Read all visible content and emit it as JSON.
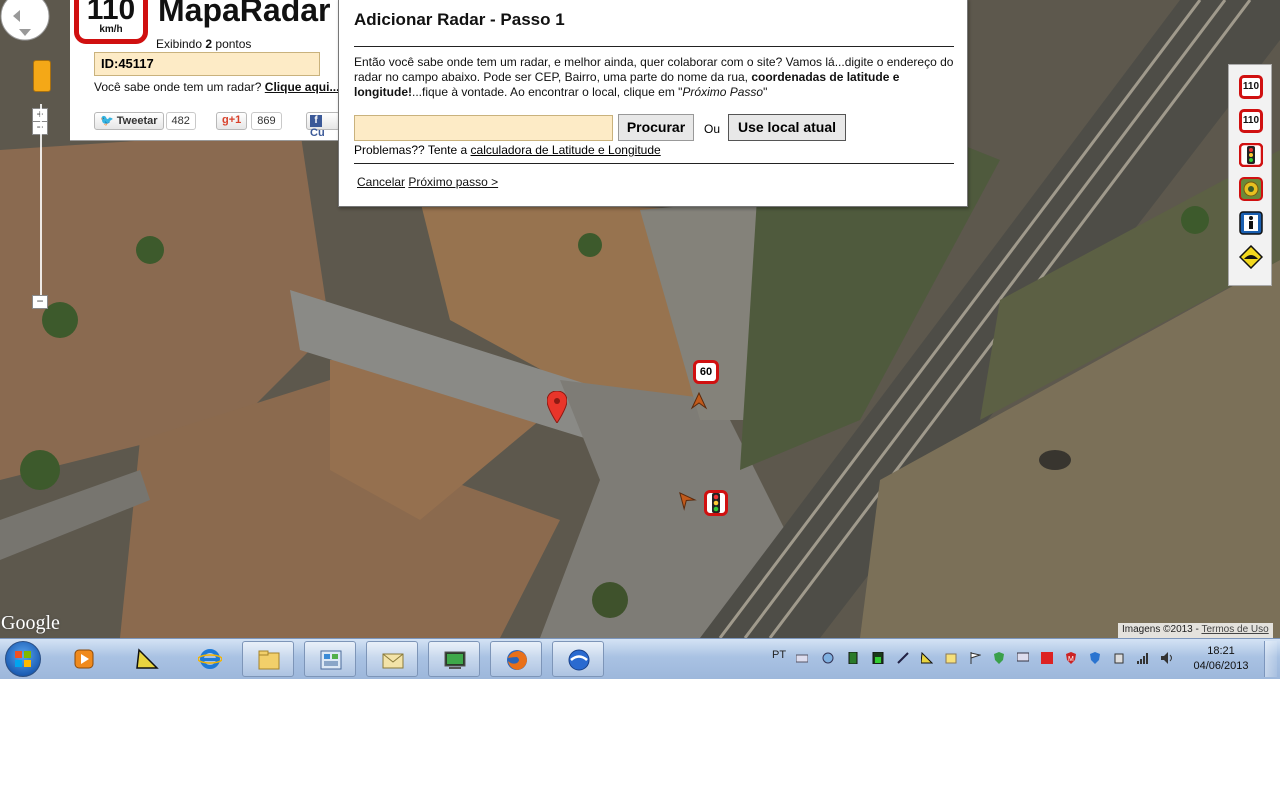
{
  "brand": {
    "sign_value": "110",
    "sign_unit": "km/h",
    "title": "MapaRadar",
    "points_prefix": "Exibindo ",
    "points_count": "2",
    "points_suffix": " pontos",
    "id_label": "ID:45117",
    "know_text": "Você sabe onde tem um radar? ",
    "know_link": "Clique aqui..."
  },
  "social": {
    "tweet_label": "Tweetar",
    "tweet_count": "482",
    "gplus_label": "+1",
    "gplus_count": "869",
    "fb_label": "Cu"
  },
  "dialog": {
    "title": "Adicionar Radar - Passo 1",
    "body_1": "Então você sabe onde tem um radar, e melhor ainda, quer colaborar com o site? Vamos lá...digite o endereço do radar no campo abaixo. Pode ser CEP, Bairro, uma parte do nome da rua, ",
    "body_bold": "coordenadas de latitude e longitude!",
    "body_2": "...fique à vontade. Ao encontrar o local, clique em \"",
    "body_italic": "Próximo Passo",
    "body_3": "\"",
    "address_value": "",
    "search_button": "Procurar",
    "or_text": "Ou",
    "use_location_button": "Use local atual",
    "problems_prefix": "Problemas?? Tente a ",
    "problems_link": "calculadora de Latitude e Longitude",
    "cancel_link": "Cancelar",
    "next_link": "Próximo passo >"
  },
  "map": {
    "marker_speed": "60",
    "google_logo": "Google",
    "imagery_text": "Imagens ©2013 - ",
    "terms_link": "Termos de Uso",
    "zoom_in": "+",
    "zoom_out": "−"
  },
  "toolbar": {
    "items": [
      {
        "label": "110",
        "icon": "speed-radar-110-icon"
      },
      {
        "label": "110",
        "icon": "speed-radar-110-alt-icon"
      },
      {
        "label": "",
        "icon": "traffic-light-icon"
      },
      {
        "label": "",
        "icon": "police-badge-icon"
      },
      {
        "label": "",
        "icon": "pedestrian-icon"
      },
      {
        "label": "",
        "icon": "speed-bump-icon"
      }
    ]
  },
  "taskbar": {
    "apps": [
      {
        "name": "media-player",
        "open": false
      },
      {
        "name": "geometry-app",
        "open": false
      },
      {
        "name": "internet-explorer",
        "open": false
      },
      {
        "name": "file-explorer",
        "open": true
      },
      {
        "name": "control-panel",
        "open": true
      },
      {
        "name": "mail-app",
        "open": true
      },
      {
        "name": "terminal-app",
        "open": true
      },
      {
        "name": "firefox",
        "open": true
      },
      {
        "name": "google-earth",
        "open": true
      }
    ],
    "language": "PT",
    "time": "18:21",
    "date": "04/06/2013"
  },
  "colors": {
    "input_bg": "#fdebc6",
    "sign_red": "#d01010",
    "taskbar_blue": "#a9c2e3"
  }
}
